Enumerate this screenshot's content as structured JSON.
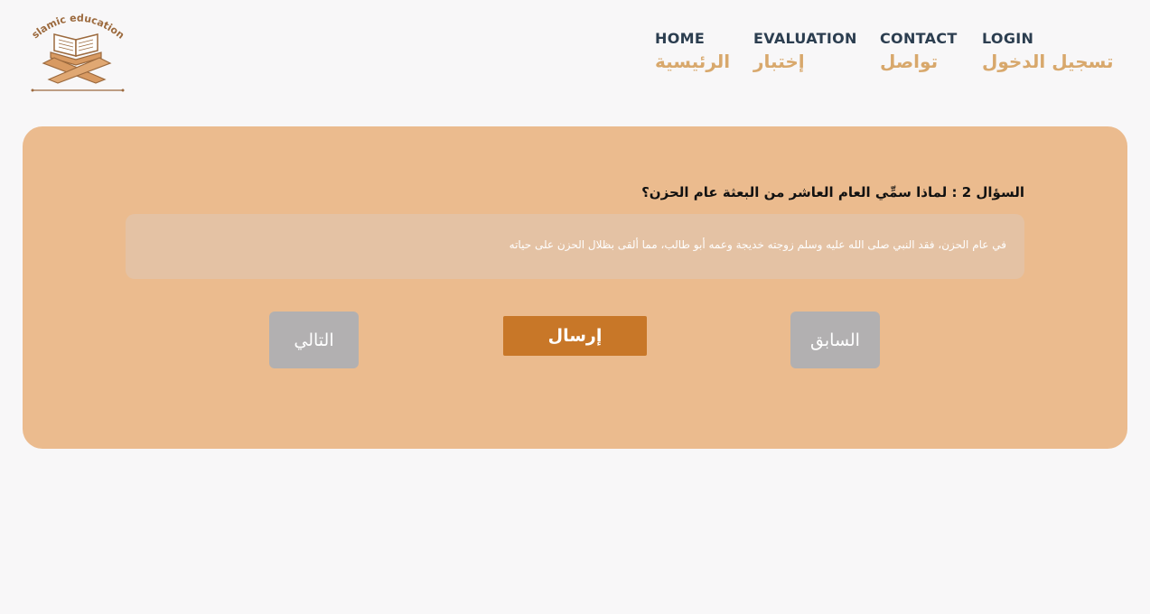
{
  "logo": {
    "text": "islamic education",
    "icon": "quran-stand-icon"
  },
  "nav": {
    "items": [
      {
        "en": "HOME",
        "ar": "الرئيسية"
      },
      {
        "en": "EVALUATION",
        "ar": "إختبار"
      },
      {
        "en": "CONTACT",
        "ar": "تواصل"
      },
      {
        "en": "LOGIN",
        "ar": "تسجيل الدخول"
      }
    ]
  },
  "quiz": {
    "question": "السؤال 2 : لماذا سمِّي العام العاشر من البعثة عام الحزن؟",
    "answer": "في عام الحزن، فقد النبي صلى الله عليه وسلم زوجته خديجة وعمه أبو طالب، مما ألقى بظلال الحزن على حياته",
    "buttons": {
      "next": "التالي",
      "submit": "إرسال",
      "previous": "السابق"
    }
  },
  "colors": {
    "background": "#f8f7f8",
    "card": "#ebbb8e",
    "answer_box": "#e4c2a4",
    "submit": "#c87728",
    "nav_button": "#b2b0b1",
    "nav_en": "#2c3e50",
    "nav_ar": "#d8a86c"
  }
}
